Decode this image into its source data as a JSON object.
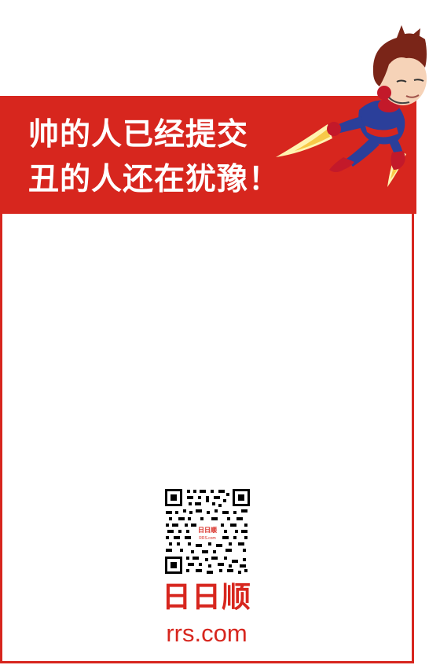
{
  "banner": {
    "line1": "帅的人已经提交",
    "line2": "丑的人还在犹豫！",
    "color": "#d7261e"
  },
  "mascot": {
    "icon": "flying-hero-mascot-icon"
  },
  "qr": {
    "icon": "qr-code-icon",
    "center_logo_text": "日日顺",
    "center_logo_domain": "RRS.com"
  },
  "brand": {
    "name": "日日顺",
    "domain": "rrs.com"
  }
}
